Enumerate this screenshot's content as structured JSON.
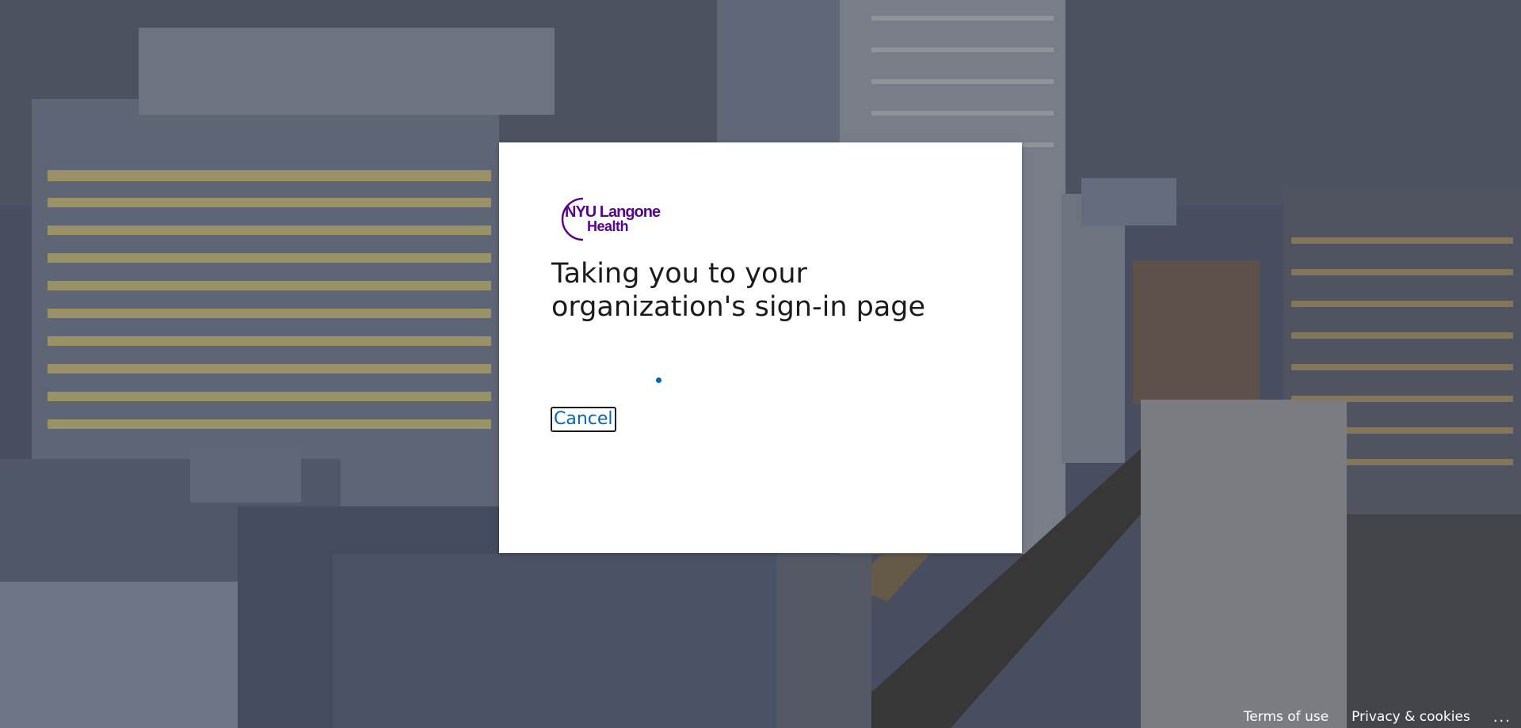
{
  "logo": {
    "line1": "NYU Langone",
    "line2": "Health",
    "brand_color": "#57068c"
  },
  "title": "Taking you to your organization's sign-in page",
  "progress": {
    "accent_color": "#0067b8"
  },
  "cancel_label": "Cancel",
  "footer": {
    "terms": "Terms of use",
    "privacy": "Privacy & cookies",
    "more": "..."
  }
}
